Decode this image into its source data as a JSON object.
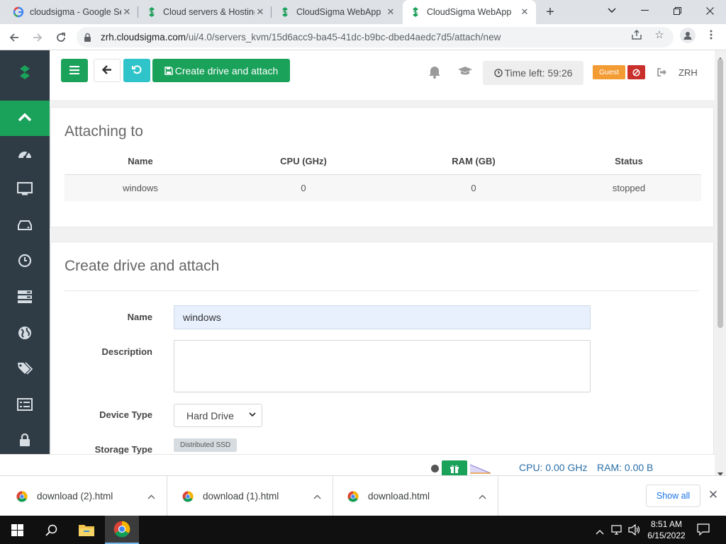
{
  "browser": {
    "tabs": [
      {
        "title": "cloudsigma - Google Se",
        "favicon": "google-g-icon",
        "active": false
      },
      {
        "title": "Cloud servers & Hosting",
        "favicon": "cloudsigma-icon",
        "active": false
      },
      {
        "title": "CloudSigma WebApp",
        "favicon": "cloudsigma-icon",
        "active": false
      },
      {
        "title": "CloudSigma WebApp",
        "favicon": "cloudsigma-icon",
        "active": true
      }
    ],
    "url_host": "zrh.cloudsigma.com",
    "url_path": "/ui/4.0/servers_kvm/15d6acc9-ba45-41dc-b9bc-dbed4aedc7d5/attach/new"
  },
  "colors": {
    "brand_green": "#1aa15a",
    "sidebar_bg": "#2f3b45",
    "teal": "#2ec4c9",
    "guest_orange": "#f39c34",
    "stop_red": "#c9302c",
    "metric_blue": "#2a6fa8"
  },
  "sidebar": {
    "items": [
      {
        "icon": "chevron-up-icon"
      },
      {
        "icon": "dashboard-gauge-icon"
      },
      {
        "icon": "monitor-icon"
      },
      {
        "icon": "hard-drive-icon"
      },
      {
        "icon": "clock-icon"
      },
      {
        "icon": "server-rack-icon"
      },
      {
        "icon": "globe-icon"
      },
      {
        "icon": "tags-icon"
      },
      {
        "icon": "list-icon"
      },
      {
        "icon": "lock-icon"
      }
    ]
  },
  "appbar": {
    "create_label": "Create drive and attach",
    "time_left": "Time left: 59:26",
    "guest_badge": "Guest",
    "region": "ZRH"
  },
  "attach": {
    "title": "Attaching to",
    "columns": [
      "Name",
      "CPU (GHz)",
      "RAM (GB)",
      "Status"
    ],
    "rows": [
      [
        "windows",
        "0",
        "0",
        "stopped"
      ]
    ]
  },
  "form": {
    "title": "Create drive and attach",
    "name_label": "Name",
    "name_value": "windows",
    "description_label": "Description",
    "description_value": "",
    "device_type_label": "Device Type",
    "device_type_value": "Hard Drive",
    "storage_type_label": "Storage Type",
    "storage_type_value": "Distributed SSD"
  },
  "status": {
    "cpu": "CPU: 0.00 GHz",
    "ram": "RAM: 0.00 B"
  },
  "downloads": {
    "items": [
      "download (2).html",
      "download (1).html",
      "download.html"
    ],
    "show_all": "Show all"
  },
  "taskbar": {
    "time": "8:51 AM",
    "date": "6/15/2022"
  }
}
